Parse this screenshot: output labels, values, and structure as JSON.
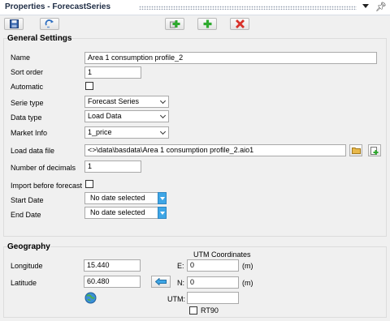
{
  "window": {
    "title": "Properties - ForecastSeries"
  },
  "toolbar": {
    "save_icon": "save-icon",
    "refresh_icon": "refresh-icon",
    "new_copy_icon": "add-copy-icon",
    "add_icon": "add-icon",
    "delete_icon": "delete-icon"
  },
  "general": {
    "section_title": "General Settings",
    "name_label": "Name",
    "name_value": "Area 1 consumption profile_2",
    "sort_order_label": "Sort order",
    "sort_order_value": "1",
    "automatic_label": "Automatic",
    "serie_type_label": "Serie type",
    "serie_type_value": "Forecast Series",
    "data_type_label": "Data type",
    "data_type_value": "Load Data",
    "market_info_label": "Market Info",
    "market_info_value": "1_price",
    "load_file_label": "Load data file",
    "load_file_value": "<>\\data\\basdata\\Area 1 consumption profile_2.aio1",
    "decimals_label": "Number of decimals",
    "decimals_value": "1",
    "import_label": "Import before forecast",
    "start_date_label": "Start Date",
    "start_date_value": "No date selected",
    "end_date_label": "End Date",
    "end_date_value": "No date selected"
  },
  "geography": {
    "section_title": "Geography",
    "longitude_label": "Longitude",
    "longitude_value": "15.440",
    "latitude_label": "Latitude",
    "latitude_value": "60.480",
    "utm_title": "UTM Coordinates",
    "e_label": "E:",
    "e_value": "0",
    "e_unit": "(m)",
    "n_label": "N:",
    "n_value": "0",
    "n_unit": "(m)",
    "utm_label": "UTM:",
    "utm_value": "",
    "rt90_label": "RT90"
  },
  "colors": {
    "title": "#1e2c44",
    "accent_blue": "#3ea6e6",
    "add_green": "#2eaa2e",
    "delete_red": "#d8312a"
  }
}
